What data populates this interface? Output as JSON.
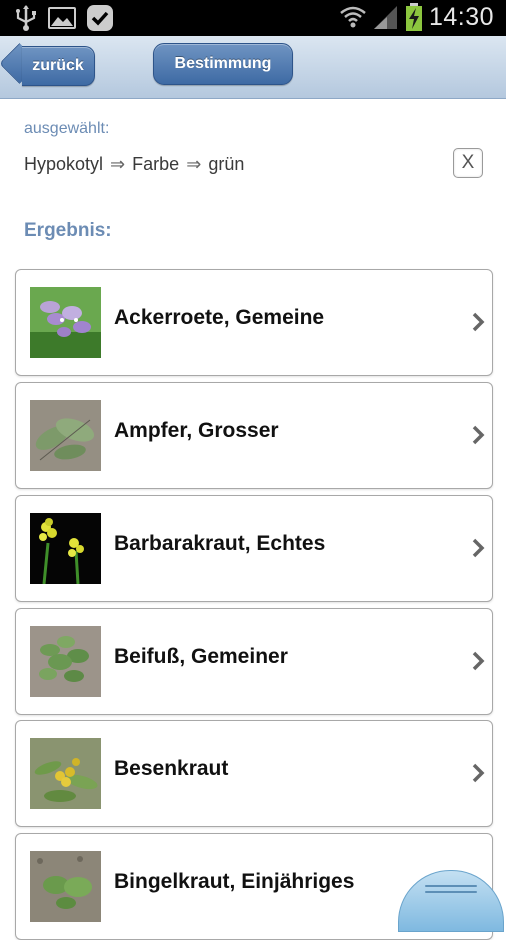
{
  "status_bar": {
    "time": "14:30",
    "left_icons": [
      "usb-icon",
      "image-icon",
      "check-icon"
    ],
    "right_icons": [
      "wifi-icon",
      "signal-icon",
      "battery-icon"
    ]
  },
  "navbar": {
    "back_label": "zurück",
    "center_label": "Bestimmung"
  },
  "selection": {
    "label": "ausgewählt:",
    "path": [
      "Hypokotyl",
      "Farbe",
      "grün"
    ],
    "separator": "⇒",
    "clear_label": "X"
  },
  "results": {
    "title": "Ergebnis:",
    "items": [
      {
        "name": "Ackerroete, Gemeine",
        "thumb": "purple-flower-thumbnail"
      },
      {
        "name": "Ampfer, Grosser",
        "thumb": "dock-leaf-thumbnail"
      },
      {
        "name": "Barbarakraut, Echtes",
        "thumb": "yellow-flower-thumbnail"
      },
      {
        "name": "Beifuß, Gemeiner",
        "thumb": "mugwort-leaf-thumbnail"
      },
      {
        "name": "Besenkraut",
        "thumb": "yellow-bud-thumbnail"
      },
      {
        "name": "Bingelkraut, Einjähriges",
        "thumb": "seedling-thumbnail"
      }
    ]
  },
  "colors": {
    "accent": "#6c8cb4",
    "button": "#4f7bb3",
    "navbar": "#c6d6e8"
  }
}
